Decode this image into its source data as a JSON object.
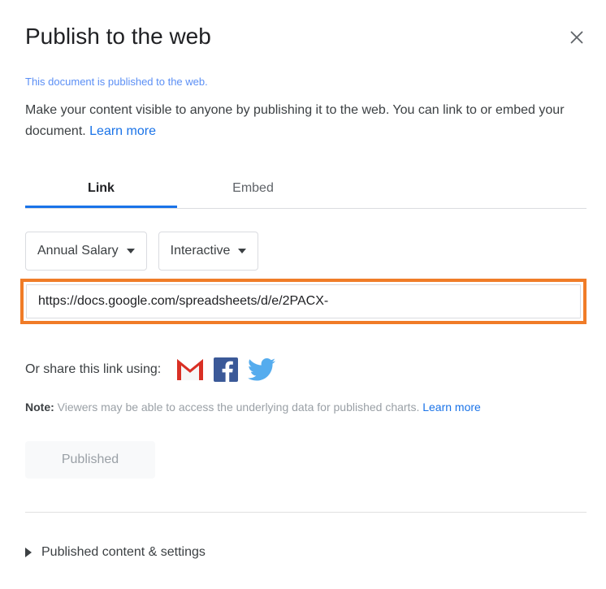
{
  "dialog": {
    "title": "Publish to the web",
    "close_icon": "close-icon",
    "status_text": "This document is published to the web.",
    "description_text": "Make your content visible to anyone by publishing it to the web. You can link to or embed your document. ",
    "description_link": "Learn more"
  },
  "tabs": [
    {
      "label": "Link",
      "active": true
    },
    {
      "label": "Embed",
      "active": false
    }
  ],
  "selectors": [
    {
      "label": "Annual Salary",
      "icon": "chevron-down-icon"
    },
    {
      "label": "Interactive",
      "icon": "chevron-down-icon"
    }
  ],
  "url_field": {
    "value": "https://docs.google.com/spreadsheets/d/e/2PACX-",
    "placeholder": "",
    "highlight_color": "#f07c28"
  },
  "share": {
    "label": "Or share this link using:",
    "icons": [
      {
        "name": "gmail-icon",
        "title": "Gmail"
      },
      {
        "name": "facebook-icon",
        "title": "Facebook"
      },
      {
        "name": "twitter-icon",
        "title": "Twitter"
      }
    ]
  },
  "note": {
    "prefix": "Note:",
    "text": " Viewers may be able to access the underlying data for published charts. ",
    "link": "Learn more"
  },
  "publish_button": {
    "label": "Published"
  },
  "footer": {
    "disclosure_label": "Published content & settings",
    "disclosure_icon": "triangle-right-icon"
  },
  "colors": {
    "accent_blue": "#1a73e8",
    "status_blue": "#5b8ff5",
    "highlight_orange": "#f07c28",
    "text_primary": "#202124",
    "text_secondary": "#3c4043",
    "text_muted": "#9aa0a6"
  }
}
